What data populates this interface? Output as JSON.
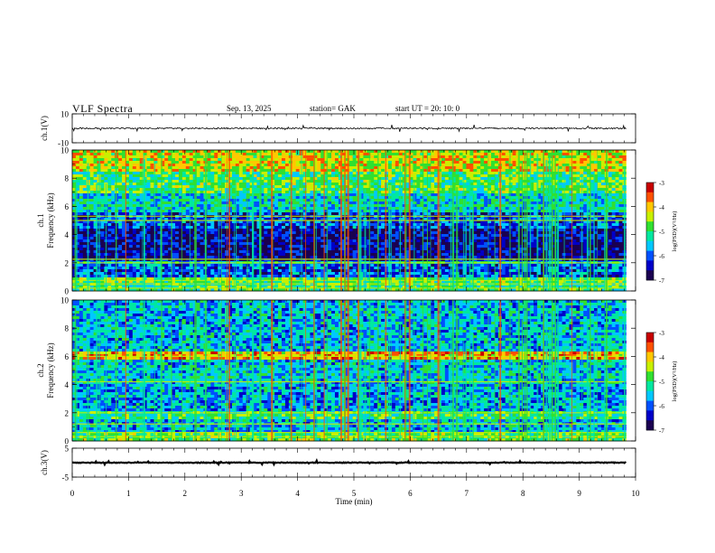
{
  "header": {
    "title": "VLF  Spectra",
    "date": "Sep. 13, 2025",
    "station": "station= GAK",
    "start_ut": "start  UT  =    20: 10: 0"
  },
  "chart_data": {
    "type": "heatmap",
    "x": {
      "label": "Time  (min)",
      "range": [
        0,
        10
      ],
      "ticks": [
        "0",
        "1",
        "2",
        "3",
        "4",
        "5",
        "6",
        "7",
        "8",
        "9",
        "10"
      ],
      "data_end_min": 9.83
    },
    "panels": [
      {
        "type": "line",
        "ylabel": "ch.1(V)",
        "ylim": [
          -10,
          10
        ],
        "yticks": [
          "10",
          "-10"
        ],
        "baseline": 0,
        "noise_amplitude": 1,
        "line_color": "#000000"
      },
      {
        "type": "heatmap",
        "ylabel_top": "ch.1",
        "ylabel": "Frequency  (kHz)",
        "ylim": [
          0,
          10
        ],
        "yticks": [
          "0",
          "2",
          "4",
          "6",
          "8",
          "10"
        ],
        "colorbar": {
          "label": "log(PSD)(V²/Hz)",
          "range": [
            -7,
            -3
          ],
          "ticks": [
            "-3",
            "-4",
            "-5",
            "-6",
            "-7"
          ]
        },
        "bands": [
          {
            "from": 0,
            "to": 0.5,
            "log_psd": -5.0
          },
          {
            "from": 0.5,
            "to": 1.0,
            "log_psd": -4.8
          },
          {
            "from": 1.0,
            "to": 2.0,
            "log_psd": -6.0
          },
          {
            "from": 2.0,
            "to": 2.2,
            "log_psd": -5.4
          },
          {
            "from": 2.2,
            "to": 4.5,
            "log_psd": -6.6
          },
          {
            "from": 4.5,
            "to": 5.5,
            "log_psd": -6.1
          },
          {
            "from": 5.5,
            "to": 7.0,
            "log_psd": -5.4
          },
          {
            "from": 7.0,
            "to": 8.5,
            "log_psd": -4.9
          },
          {
            "from": 8.5,
            "to": 10.0,
            "log_psd": -4.3
          }
        ],
        "lines_khz": [
          0.2,
          0.5,
          0.75,
          2.0,
          2.25,
          5.0,
          5.3
        ]
      },
      {
        "type": "heatmap",
        "ylabel_top": "ch.2",
        "ylabel": "Frequency  (kHz)",
        "ylim": [
          0,
          10
        ],
        "yticks": [
          "0",
          "2",
          "4",
          "6",
          "8",
          "10"
        ],
        "colorbar": {
          "label": "log(PSD)(V²/Hz)",
          "range": [
            -7,
            -3
          ],
          "ticks": [
            "-3",
            "-4",
            "-5",
            "-6",
            "-7"
          ]
        },
        "bands": [
          {
            "from": 0,
            "to": 0.6,
            "log_psd": -4.8
          },
          {
            "from": 0.6,
            "to": 1.6,
            "log_psd": -5.6
          },
          {
            "from": 1.6,
            "to": 2.2,
            "log_psd": -5.0
          },
          {
            "from": 2.2,
            "to": 4.0,
            "log_psd": -5.7
          },
          {
            "from": 4.0,
            "to": 5.7,
            "log_psd": -5.5
          },
          {
            "from": 5.7,
            "to": 6.3,
            "log_psd": -3.9
          },
          {
            "from": 6.3,
            "to": 10.0,
            "log_psd": -5.6
          }
        ],
        "lines_khz": [
          0.3,
          0.6,
          1.2,
          2.0,
          4.2,
          6.0
        ]
      },
      {
        "type": "line",
        "ylabel": "ch.3(V)",
        "ylim": [
          -5,
          5
        ],
        "yticks": [
          "5",
          "-5"
        ],
        "baseline": 0,
        "noise_amplitude": 0.25,
        "line_color": "#000000"
      }
    ],
    "colormap": [
      "#1a0050",
      "#0000c8",
      "#0050ff",
      "#00c8ff",
      "#00e8a0",
      "#30e030",
      "#c8f000",
      "#ffc800",
      "#ff5000",
      "#c80000"
    ]
  }
}
